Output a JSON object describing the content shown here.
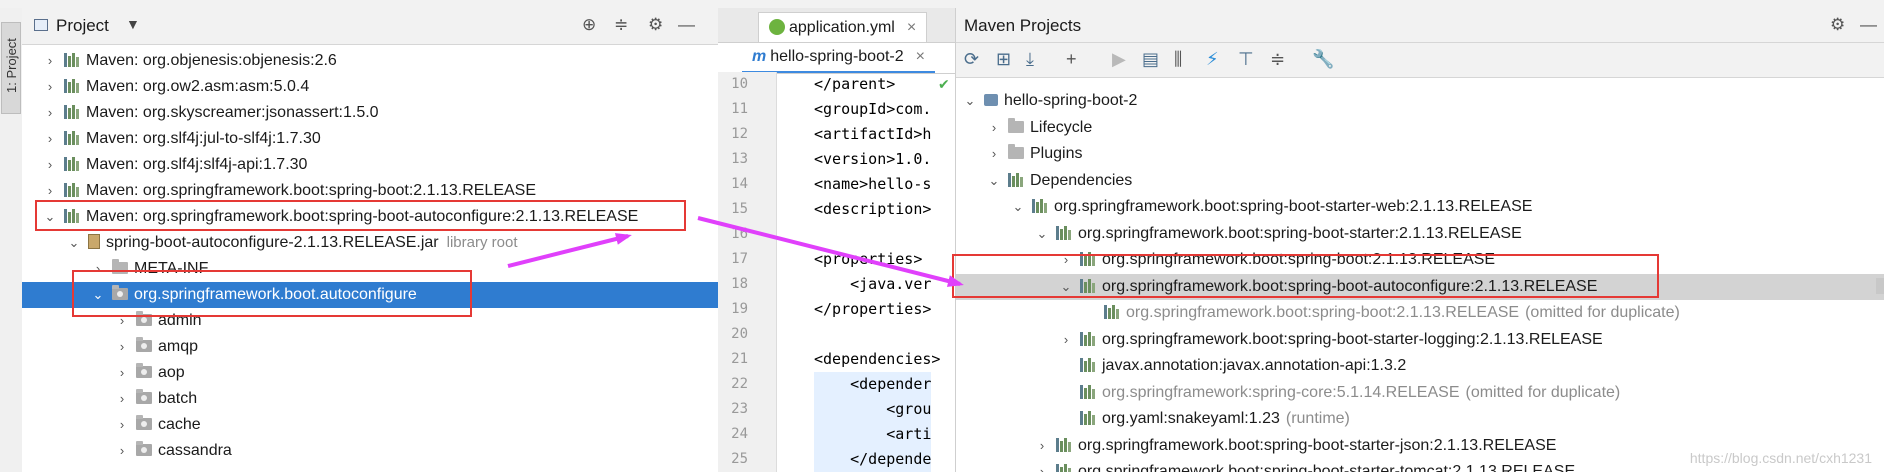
{
  "sidebar": {
    "tab_label": "1: Project"
  },
  "project_panel": {
    "title": "Project",
    "dropdown_arrow": "▼",
    "header_icons": [
      "locate-icon",
      "collapse-icon",
      "gear-icon",
      "minimize-icon"
    ],
    "rows": [
      {
        "indent": 0,
        "arrow": "›",
        "icon": "library-icon",
        "label": "Maven: org.objenesis:objenesis:2.6",
        "suffix": ""
      },
      {
        "indent": 0,
        "arrow": "›",
        "icon": "library-icon",
        "label": "Maven: org.ow2.asm:asm:5.0.4",
        "suffix": ""
      },
      {
        "indent": 0,
        "arrow": "›",
        "icon": "library-icon",
        "label": "Maven: org.skyscreamer:jsonassert:1.5.0",
        "suffix": ""
      },
      {
        "indent": 0,
        "arrow": "›",
        "icon": "library-icon",
        "label": "Maven: org.slf4j:jul-to-slf4j:1.7.30",
        "suffix": ""
      },
      {
        "indent": 0,
        "arrow": "›",
        "icon": "library-icon",
        "label": "Maven: org.slf4j:slf4j-api:1.7.30",
        "suffix": ""
      },
      {
        "indent": 0,
        "arrow": "›",
        "icon": "library-icon",
        "label": "Maven: org.springframework.boot:spring-boot:2.1.13.RELEASE",
        "suffix": ""
      },
      {
        "indent": 0,
        "arrow": "⌄",
        "icon": "library-icon",
        "label": "Maven: org.springframework.boot:spring-boot-autoconfigure:2.1.13.RELEASE",
        "suffix": ""
      },
      {
        "indent": 1,
        "arrow": "⌄",
        "icon": "jar-icon",
        "label": "spring-boot-autoconfigure-2.1.13.RELEASE.jar",
        "suffix": "library root"
      },
      {
        "indent": 2,
        "arrow": "›",
        "icon": "folder-icon",
        "label": "META-INF",
        "suffix": ""
      },
      {
        "indent": 2,
        "arrow": "⌄",
        "icon": "package-icon",
        "label": "org.springframework.boot.autoconfigure",
        "suffix": "",
        "selected": true
      },
      {
        "indent": 3,
        "arrow": "›",
        "icon": "package-icon",
        "label": "admin",
        "suffix": ""
      },
      {
        "indent": 3,
        "arrow": "›",
        "icon": "package-icon",
        "label": "amqp",
        "suffix": ""
      },
      {
        "indent": 3,
        "arrow": "›",
        "icon": "package-icon",
        "label": "aop",
        "suffix": ""
      },
      {
        "indent": 3,
        "arrow": "›",
        "icon": "package-icon",
        "label": "batch",
        "suffix": ""
      },
      {
        "indent": 3,
        "arrow": "›",
        "icon": "package-icon",
        "label": "cache",
        "suffix": ""
      },
      {
        "indent": 3,
        "arrow": "›",
        "icon": "package-icon",
        "label": "cassandra",
        "suffix": ""
      }
    ]
  },
  "editor": {
    "tab_top": "application.yml",
    "tab_active": "hello-spring-boot-2",
    "close_glyph": "×",
    "lines": [
      {
        "n": "10",
        "text": "</parent>"
      },
      {
        "n": "11",
        "text": "<groupId>com."
      },
      {
        "n": "12",
        "text": "<artifactId>h"
      },
      {
        "n": "13",
        "text": "<version>1.0."
      },
      {
        "n": "14",
        "text": "<name>hello-s"
      },
      {
        "n": "15",
        "text": "<description>"
      },
      {
        "n": "16",
        "text": ""
      },
      {
        "n": "17",
        "text": "<properties>"
      },
      {
        "n": "18",
        "text": "    <java.ver"
      },
      {
        "n": "19",
        "text": "</properties>"
      },
      {
        "n": "20",
        "text": ""
      },
      {
        "n": "21",
        "text": "<dependencies>"
      },
      {
        "n": "22",
        "text": "    <depender"
      },
      {
        "n": "23",
        "text": "        <grou"
      },
      {
        "n": "24",
        "text": "        <arti"
      },
      {
        "n": "25",
        "text": "    </depende"
      }
    ]
  },
  "maven_panel": {
    "title": "Maven Projects",
    "toolbar_icons": [
      "refresh-icon",
      "add-project-icon",
      "download-icon",
      "plus-icon",
      "run-icon",
      "execute-goal-icon",
      "toggle-offline-icon",
      "skip-tests-icon",
      "show-deps-icon",
      "collapse-all-icon",
      "settings-wrench-icon"
    ],
    "rows": [
      {
        "indent": 0,
        "arrow": "⌄",
        "icon": "maven-project-icon",
        "label": "hello-spring-boot-2",
        "suffix": "",
        "muted": false
      },
      {
        "indent": 1,
        "arrow": "›",
        "icon": "folder-icon",
        "label": "Lifecycle",
        "suffix": "",
        "muted": false
      },
      {
        "indent": 1,
        "arrow": "›",
        "icon": "folder-icon",
        "label": "Plugins",
        "suffix": "",
        "muted": false
      },
      {
        "indent": 1,
        "arrow": "⌄",
        "icon": "library-icon",
        "label": "Dependencies",
        "suffix": "",
        "muted": false
      },
      {
        "indent": 2,
        "arrow": "⌄",
        "icon": "library-icon",
        "label": "org.springframework.boot:spring-boot-starter-web:2.1.13.RELEASE",
        "suffix": "",
        "muted": false
      },
      {
        "indent": 3,
        "arrow": "⌄",
        "icon": "library-icon",
        "label": "org.springframework.boot:spring-boot-starter:2.1.13.RELEASE",
        "suffix": "",
        "muted": false
      },
      {
        "indent": 4,
        "arrow": "›",
        "icon": "library-icon",
        "label": "org.springframework.boot:spring-boot:2.1.13.RELEASE",
        "suffix": "",
        "muted": false
      },
      {
        "indent": 4,
        "arrow": "⌄",
        "icon": "library-icon",
        "label": "org.springframework.boot:spring-boot-autoconfigure:2.1.13.RELEASE",
        "suffix": "",
        "muted": false,
        "selected": true
      },
      {
        "indent": 5,
        "arrow": "",
        "icon": "library-icon",
        "label": "org.springframework.boot:spring-boot:2.1.13.RELEASE",
        "suffix": "(omitted for duplicate)",
        "muted": true
      },
      {
        "indent": 4,
        "arrow": "›",
        "icon": "library-icon",
        "label": "org.springframework.boot:spring-boot-starter-logging:2.1.13.RELEASE",
        "suffix": "",
        "muted": false
      },
      {
        "indent": 4,
        "arrow": "",
        "icon": "library-icon",
        "label": "javax.annotation:javax.annotation-api:1.3.2",
        "suffix": "",
        "muted": false
      },
      {
        "indent": 4,
        "arrow": "",
        "icon": "library-icon",
        "label": "org.springframework:spring-core:5.1.14.RELEASE",
        "suffix": "(omitted for duplicate)",
        "muted": true
      },
      {
        "indent": 4,
        "arrow": "",
        "icon": "library-icon",
        "label": "org.yaml:snakeyaml:1.23",
        "suffix": "(runtime)",
        "muted": false
      },
      {
        "indent": 3,
        "arrow": "›",
        "icon": "library-icon",
        "label": "org.springframework.boot:spring-boot-starter-json:2.1.13.RELEASE",
        "suffix": "",
        "muted": false
      },
      {
        "indent": 3,
        "arrow": "›",
        "icon": "library-icon",
        "label": "org.springframework.boot:spring-boot-starter-tomcat:2.1.13.RELEASE",
        "suffix": "",
        "muted": false
      }
    ]
  },
  "watermark": "https://blog.csdn.net/cxh1231",
  "colors": {
    "selection": "#2f7cd0",
    "highlight_box": "#e53935",
    "arrow": "#e040fb"
  }
}
